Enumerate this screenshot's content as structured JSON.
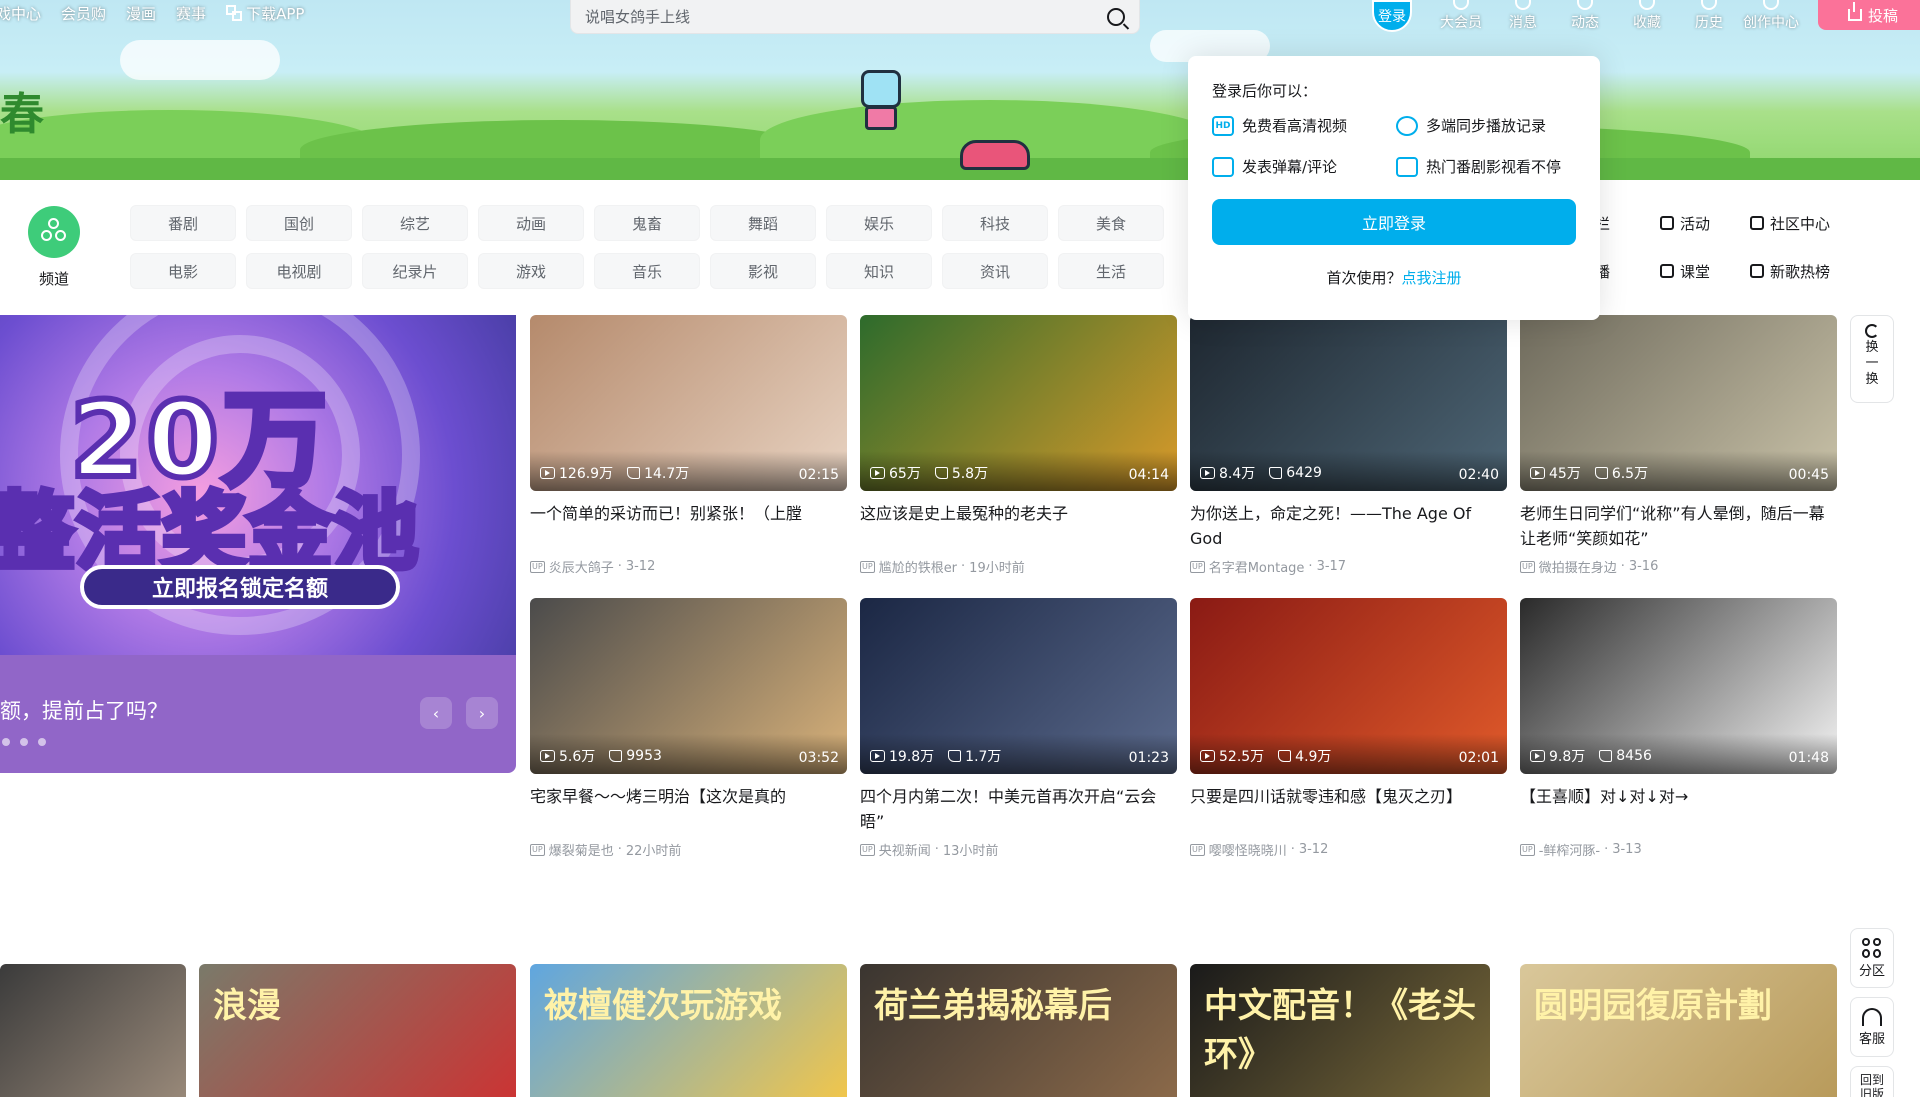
{
  "top_nav": {
    "items": [
      "戏中心",
      "会员购",
      "漫画",
      "赛事"
    ],
    "download": "下载APP"
  },
  "search": {
    "placeholder": "说唱女鸽手上线"
  },
  "user_nav": {
    "login": "登录",
    "items": [
      "大会员",
      "消息",
      "动态",
      "收藏",
      "历史",
      "创作中心"
    ],
    "upload": "投稿"
  },
  "banner": {
    "sign": "春"
  },
  "channel": {
    "label": "频道"
  },
  "categories": [
    "番剧",
    "国创",
    "综艺",
    "动画",
    "鬼畜",
    "舞蹈",
    "娱乐",
    "科技",
    "美食",
    "电影",
    "电视剧",
    "纪录片",
    "游戏",
    "音乐",
    "影视",
    "知识",
    "资讯",
    "生活"
  ],
  "side_links": [
    "专栏",
    "活动",
    "社区中心",
    "直播",
    "课堂",
    "新歌热榜"
  ],
  "login_popup": {
    "title": "登录后你可以：",
    "benefits": [
      "免费看高清视频",
      "多端同步播放记录",
      "发表弹幕/评论",
      "热门番剧影视看不停"
    ],
    "hd_badge": "HD",
    "login_button": "立即登录",
    "first_use": "首次使用？",
    "register": "点我注册"
  },
  "carousel": {
    "big_text": "20万",
    "sub_text": "整活奖金池",
    "ribbon": "立即报名锁定名额",
    "caption": "额，提前占了吗？",
    "prev": "‹",
    "next": "›"
  },
  "videos": [
    {
      "title": "一个简单的采访而已！别紧张！（上膛",
      "author": "炎辰大鸽子",
      "date": "3-12",
      "plays": "126.9万",
      "likes": "14.7万",
      "duration": "02:15",
      "colors": [
        "#b58a6c",
        "#e8d3c2"
      ]
    },
    {
      "title": "这应该是史上最冤种的老夫子",
      "author": "尴尬的铁根er",
      "date": "19小时前",
      "plays": "65万",
      "likes": "5.8万",
      "duration": "04:14",
      "colors": [
        "#2d6b2c",
        "#d99a2a"
      ]
    },
    {
      "title": "为你送上，命定之死！——The Age Of God",
      "author": "名字君Montage",
      "date": "3-17",
      "plays": "8.4万",
      "likes": "6429",
      "duration": "02:40",
      "colors": [
        "#1e2730",
        "#4e6676"
      ]
    },
    {
      "title": "老师生日同学们“讹称”有人晕倒，随后一幕让老师“笑颜如花”",
      "author": "微拍摄在身边",
      "date": "3-16",
      "plays": "45万",
      "likes": "6.5万",
      "duration": "00:45",
      "colors": [
        "#6e6a5c",
        "#c9c2a8"
      ]
    },
    {
      "title": "宅家早餐～～烤三明治【这次是真的",
      "author": "爆裂菊是也",
      "date": "22小时前",
      "plays": "5.6万",
      "likes": "9953",
      "duration": "03:52",
      "colors": [
        "#4b4b4b",
        "#d9b27a"
      ]
    },
    {
      "title": "四个月内第二次！中美元首再次开启“云会晤”",
      "author": "央视新闻",
      "date": "13小时前",
      "plays": "19.8万",
      "likes": "1.7万",
      "duration": "01:23",
      "colors": [
        "#1b2744",
        "#5b6a8c"
      ]
    },
    {
      "title": "只要是四川话就零违和感【鬼灭之刃】",
      "author": "嘤嘤怪晓晓川",
      "date": "3-12",
      "plays": "52.5万",
      "likes": "4.9万",
      "duration": "02:01",
      "colors": [
        "#8a1a14",
        "#e05a2a"
      ]
    },
    {
      "title": "【王喜顺】对↓对↓对→",
      "author": "-鲜榨河豚-",
      "date": "3-13",
      "plays": "9.8万",
      "likes": "8456",
      "duration": "01:48",
      "colors": [
        "#2a2a2a",
        "#f4f4f4"
      ]
    }
  ],
  "bottom_row": [
    {
      "text": "",
      "colors": [
        "#3b3b3b",
        "#9a8a7a"
      ]
    },
    {
      "text": "浪漫",
      "colors": [
        "#7a7a6a",
        "#c33"
      ]
    },
    {
      "text": "被檀健次玩游戏",
      "colors": [
        "#5fa6e0",
        "#f2c64a"
      ]
    },
    {
      "text": "荷兰弟揭秘幕后",
      "colors": [
        "#3a3530",
        "#8c6a4a"
      ]
    },
    {
      "text": "中文配音！《老头环》",
      "colors": [
        "#1a1a1a",
        "#7a6a3a"
      ]
    },
    {
      "text": "圆明园復原計劃",
      "colors": [
        "#d9c79a",
        "#b89a5a"
      ]
    }
  ],
  "right_float": {
    "refresh": [
      "换",
      "一",
      "换"
    ],
    "zone": "分区",
    "service": "客服",
    "old_version": "回到旧版"
  },
  "colors": {
    "accent": "#00aeec",
    "upload_pink": "#fb7299"
  }
}
